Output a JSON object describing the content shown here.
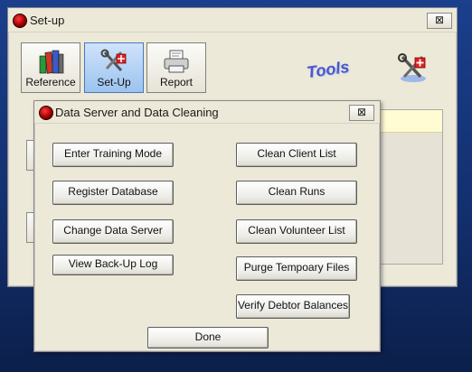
{
  "setup_window": {
    "title": "Set-up",
    "close_symbol": "⊠",
    "toolbar": [
      {
        "label": "Reference",
        "icon": "books-icon"
      },
      {
        "label": "Set-Up",
        "icon": "tools-icon"
      },
      {
        "label": "Report",
        "icon": "printer-icon"
      }
    ],
    "tools_caption": "Tools"
  },
  "dialog": {
    "title": "Data Server and Data Cleaning",
    "close_symbol": "⊠",
    "left_buttons": [
      "Enter Training Mode",
      "Register Database",
      "Change Data Server",
      "View Back-Up Log"
    ],
    "right_buttons": [
      "Clean Client List",
      "Clean Runs",
      "Clean Volunteer List",
      "Purge Tempoary Files",
      "Verify Debtor Balances"
    ],
    "done_label": "Done"
  },
  "colors": {
    "desktop": "#1b3f8c",
    "window_face": "#ece9d8",
    "panel_yellow": "#fffbd2",
    "tools_text": "#4a58c8"
  }
}
